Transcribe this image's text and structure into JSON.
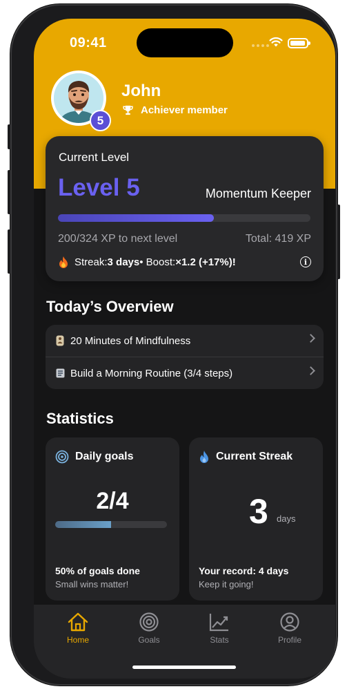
{
  "status_bar": {
    "time": "09:41"
  },
  "profile": {
    "name": "John",
    "level_badge": "5",
    "membership": "Achiever member"
  },
  "level_card": {
    "title": "Current Level",
    "level_label": "Level 5",
    "rank_name": "Momentum Keeper",
    "xp_progress_fraction": 0.6173,
    "xp_to_next": "200/324 XP to next level",
    "total_xp": "Total: 419 XP",
    "streak_prefix": "Streak: ",
    "streak_value": "3 days",
    "boost_sep": " • Boost: ",
    "boost_value": "×1.2 (+17%)!"
  },
  "overview": {
    "title": "Today’s Overview",
    "items": [
      {
        "label": "20 Minutes of Mindfulness",
        "icon": "meditation-icon"
      },
      {
        "label": "Build a Morning Routine (3/4 steps)",
        "icon": "checklist-icon"
      }
    ]
  },
  "statistics": {
    "title": "Statistics",
    "daily_goals": {
      "title": "Daily goals",
      "value": "2/4",
      "progress_fraction": 0.5,
      "summary": "50% of goals done",
      "note": "Small wins matter!"
    },
    "current_streak": {
      "title": "Current Streak",
      "value": "3",
      "unit": "days",
      "record": "Your record: 4 days",
      "note": "Keep it going!"
    }
  },
  "tabs": [
    {
      "label": "Home",
      "icon": "home-icon",
      "active": true
    },
    {
      "label": "Goals",
      "icon": "target-icon",
      "active": false
    },
    {
      "label": "Stats",
      "icon": "chart-icon",
      "active": false
    },
    {
      "label": "Profile",
      "icon": "profile-icon",
      "active": false
    }
  ],
  "colors": {
    "accent": "#e8a800",
    "level_purple": "#6a61f0",
    "card": "#28282a",
    "background": "#151516"
  }
}
